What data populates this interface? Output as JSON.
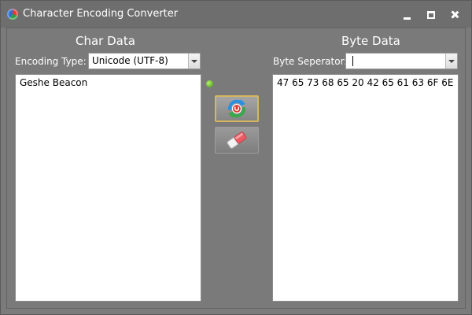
{
  "window": {
    "title": "Character Encoding Converter"
  },
  "char_panel": {
    "heading": "Char Data",
    "encoding_label": "Encoding Type:",
    "encoding_value": "Unicode (UTF-8)",
    "text": "Geshe Beacon"
  },
  "byte_panel": {
    "heading": "Byte Data",
    "separator_label": "Byte Seperator:",
    "separator_value": "",
    "bytes": "47 65 73 68 65 20 42 65 61 63 6F 6E"
  },
  "icons": {
    "app": "app-icon",
    "convert": "convert-icon",
    "clear": "eraser-icon",
    "status": "status-indicator"
  },
  "colors": {
    "window_bg": "#7b7b7b",
    "status_green": "#3e9a12",
    "convert_border": "#d6b65f"
  }
}
